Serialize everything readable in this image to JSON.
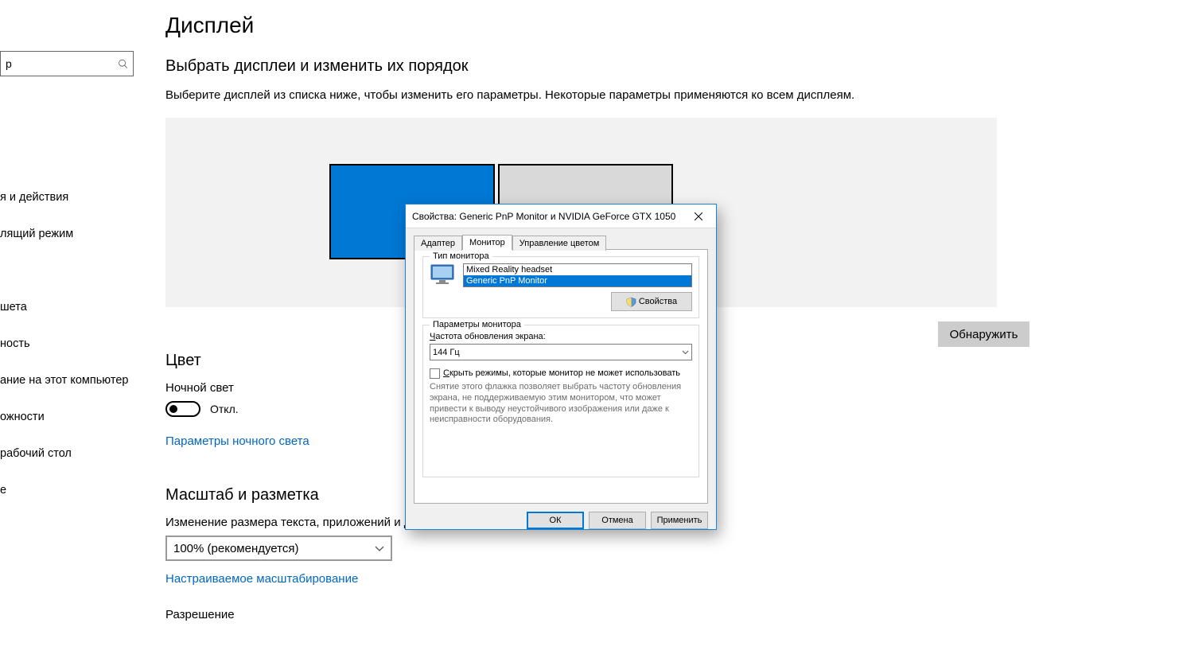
{
  "sidebar": {
    "search_value": "р",
    "items": [
      "я и действия",
      "лящий режим",
      "шета",
      "ность",
      "ание на этот компьютер",
      "ожности",
      "рабочий стол",
      "е"
    ]
  },
  "main": {
    "page_title": "Дисплей",
    "select_header": "Выбрать дисплеи и изменить их порядок",
    "select_body": "Выберите дисплей из списка ниже, чтобы изменить его параметры. Некоторые параметры применяются ко всем дисплеям.",
    "detect_button": "Обнаружить",
    "color_heading": "Цвет",
    "night_light_label": "Ночной свет",
    "toggle_state": "Откл.",
    "night_light_link": "Параметры ночного света",
    "scale_heading": "Масштаб и разметка",
    "scale_label": "Изменение размера текста, приложений и других элементов",
    "scale_value": "100% (рекомендуется)",
    "custom_scaling_link": "Настраиваемое масштабирование",
    "resolution_label": "Разрешение"
  },
  "dialog": {
    "title": "Свойства: Generic PnP Monitor и NVIDIA GeForce GTX 1050",
    "tabs": {
      "adapter": "Адаптер",
      "monitor": "Монитор",
      "color_mgmt": "Управление цветом"
    },
    "monitor_type_legend": "Тип монитора",
    "monitor_items": {
      "item0": "Mixed Reality headset",
      "item1": "Generic PnP Monitor"
    },
    "properties_button": "Свойства",
    "monitor_settings_legend": "Параметры монитора",
    "refresh_label": "Частота обновления экрана:",
    "refresh_value": "144 Гц",
    "hide_modes_checkbox": "Скрыть режимы, которые монитор не может использовать",
    "hide_modes_hint": "Снятие этого флажка позволяет выбрать частоту обновления экрана, не поддерживаемую этим монитором, что может привести к выводу неустойчивого изображения или даже к неисправности оборудования.",
    "ok": "ОК",
    "cancel": "Отмена",
    "apply": "Применить"
  }
}
